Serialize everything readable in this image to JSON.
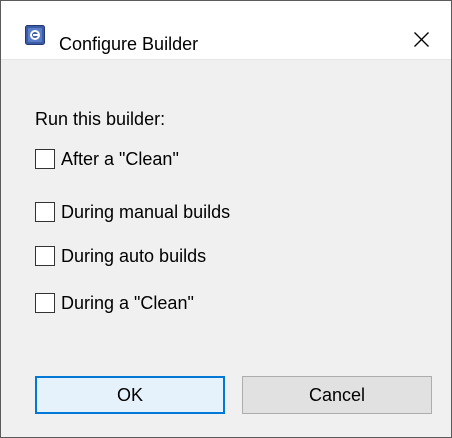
{
  "window": {
    "title": "Configure Builder",
    "close_icon": "close-icon",
    "app_icon": "eclipse-app-icon"
  },
  "dialog": {
    "heading": "Run this builder:",
    "options": [
      {
        "label": "After a \"Clean\"",
        "checked": false
      },
      {
        "label": "During manual builds",
        "checked": false
      },
      {
        "label": "During auto builds",
        "checked": false
      },
      {
        "label": "During a \"Clean\"",
        "checked": false
      }
    ]
  },
  "buttons": {
    "ok_label": "OK",
    "cancel_label": "Cancel"
  },
  "colors": {
    "accent": "#0078d7",
    "dialog_background": "#f0f0f0",
    "titlebar_background": "#ffffff",
    "icon_blue": "#3d5ca8"
  }
}
